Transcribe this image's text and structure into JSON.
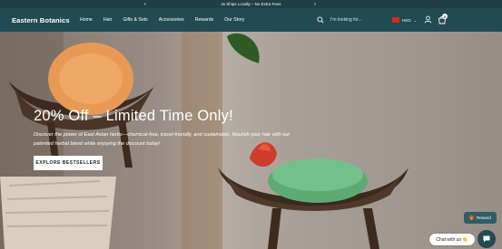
{
  "announcement": {
    "text": "ss Ships Locally – No Extra Fees",
    "prev_icon": "chevron-left-icon",
    "next_icon": "chevron-right-icon"
  },
  "header": {
    "logo": "Eastern Botanics",
    "nav": [
      "Home",
      "Hair",
      "Gifts & Sets",
      "Accessories",
      "Rewards",
      "Our Story"
    ],
    "search_placeholder": "I'm looking for...",
    "currency": "HKD",
    "cart_count": "0"
  },
  "hero": {
    "title": "20% Off – Limited Time Only!",
    "description": "Discover the power of East Asian herbs—chemical-free, travel-friendly, and sustainable. Nourish your hair with our patented herbal blend while enjoying the discount today!",
    "cta": "EXPLORE BESTSELLERS"
  },
  "widgets": {
    "reward": "Reward",
    "chat": "Chat with us 👋"
  },
  "colors": {
    "header": "#224a52",
    "announcement": "#1f3f45",
    "accent": "#2f5d66"
  }
}
